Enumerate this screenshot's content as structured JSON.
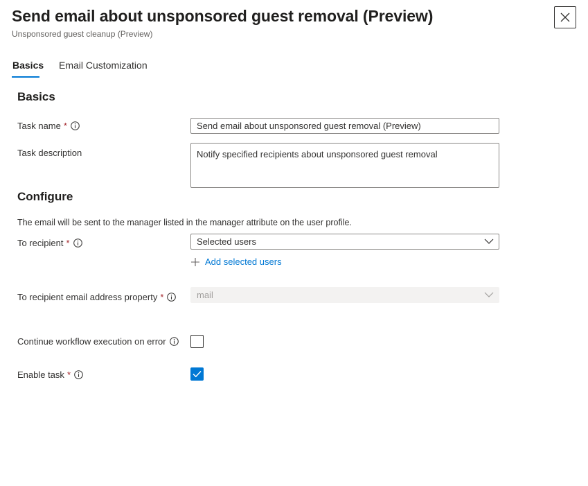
{
  "header": {
    "title": "Send email about unsponsored guest removal (Preview)",
    "subtitle": "Unsponsored guest cleanup (Preview)",
    "close_icon": "close-icon"
  },
  "tabs": [
    {
      "label": "Basics",
      "selected": true
    },
    {
      "label": "Email Customization",
      "selected": false
    }
  ],
  "colors": {
    "accent": "#0078d4",
    "required": "#a4262c"
  },
  "basics": {
    "heading": "Basics",
    "task_name": {
      "label": "Task name",
      "required_mark": "*",
      "value": "Send email about unsponsored guest removal (Preview)"
    },
    "task_description": {
      "label": "Task description",
      "value": "Notify specified recipients about unsponsored guest removal"
    }
  },
  "configure": {
    "heading": "Configure",
    "helper_text": "The email will be sent to the manager listed in the manager attribute on the user profile.",
    "to_recipient": {
      "label": "To recipient",
      "required_mark": "*",
      "selected_value": "Selected users",
      "add_link": "Add selected users"
    },
    "email_property": {
      "label": "To recipient email address property",
      "required_mark": "*",
      "selected_value": "mail",
      "disabled": true
    },
    "continue_on_error": {
      "label": "Continue workflow execution on error",
      "checked": false
    },
    "enable_task": {
      "label": "Enable task",
      "required_mark": "*",
      "checked": true
    }
  }
}
